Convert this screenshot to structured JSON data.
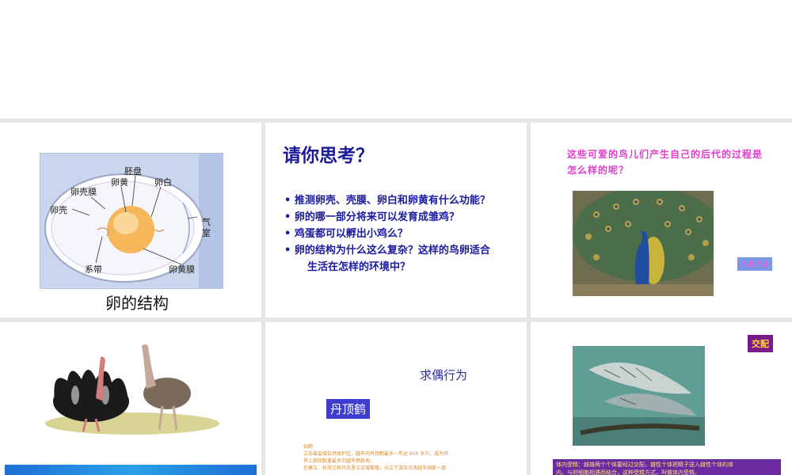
{
  "slide1": {
    "labels": {
      "embryo_disc": "胚盘",
      "yolk": "卵黄",
      "albumen": "卵白",
      "shell_membrane": "卵壳膜",
      "shell": "卵壳",
      "air_chamber_1": "气",
      "air_chamber_2": "室",
      "chalaza": "系带",
      "yolk_membrane": "卵黄膜"
    },
    "caption": "卵的结构"
  },
  "slide2": {
    "title": "请你思考？",
    "questions": [
      "推测卵壳、壳膜、卵白和卵黄有什么功能？",
      "卵的哪一部分将来可以发育成雏鸡？",
      "鸡蛋都可以孵出小鸡么？",
      "卵的结构为什么这么复杂？这样的鸟卵适合"
    ],
    "question_continuation": "生活在怎样的环境中？",
    "bullet": "•"
  },
  "slide3": {
    "question": "这些可爱的鸟儿们产生自己的后代的过程是怎么样的呢？",
    "peacock_tag": "孔雀开屏"
  },
  "slide5": {
    "title": "求偶行为",
    "crane_tag": "丹顶鹤",
    "tiny_lines": [
      "仙鹤",
      "江苏省盐城自然保护区，越冬的丹顶鹤最多一年达 600 多只，成为世",
      "界上现知数量最多的越冬栖息地。",
      "在嫩江、松花江和乌苏里江流域繁殖；长江下游及沿海越冬国家一级"
    ]
  },
  "slide6": {
    "mating_tag": "交配",
    "note_line1": "体内受精：雌雄两个个体要经过交配，雄性个体把精子送入雌性个体的体",
    "note_line2": "内，与卵细胞相遇而结合，这种受精方式，叫做体内受精。"
  },
  "colors": {
    "title_blue": "#1a1a9a",
    "pink": "#e23ccd",
    "egg_bg": "#c9d6ee",
    "yolk": "#f6b75a"
  }
}
